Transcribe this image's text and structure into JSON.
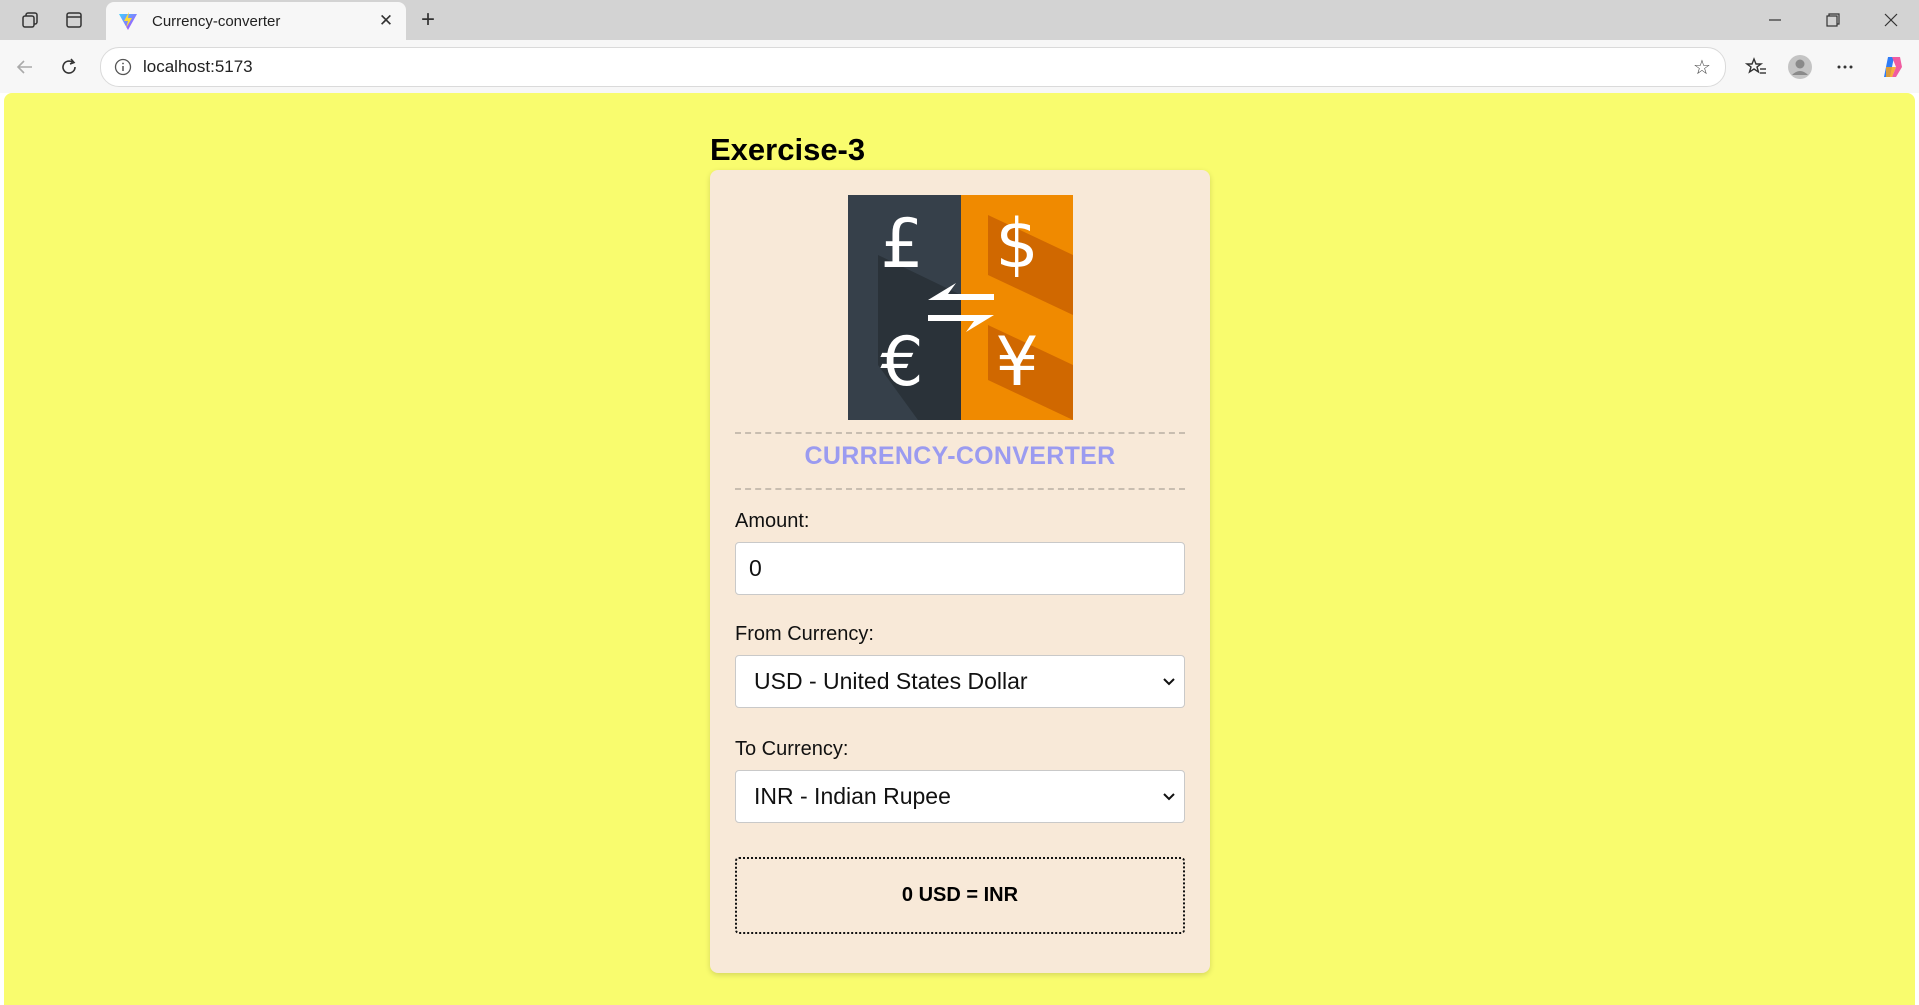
{
  "browser": {
    "tab_title": "Currency-converter",
    "url": "localhost:5173"
  },
  "page": {
    "heading": "Exercise-3"
  },
  "converter": {
    "logo_symbols": [
      "£",
      "$",
      "€",
      "¥"
    ],
    "title": "CURRENCY-CONVERTER",
    "amount_label": "Amount:",
    "amount_value": "0",
    "from_label": "From Currency:",
    "from_selected": "USD - United States Dollar",
    "to_label": "To Currency:",
    "to_selected": "INR - Indian Rupee",
    "result": "0 USD = INR"
  },
  "colors": {
    "page_background": "#f9fc6e",
    "card_background": "#f8e9d8",
    "title_color": "#9b9bf0",
    "logo_dark": "#36404a",
    "logo_orange": "#f08a00"
  }
}
